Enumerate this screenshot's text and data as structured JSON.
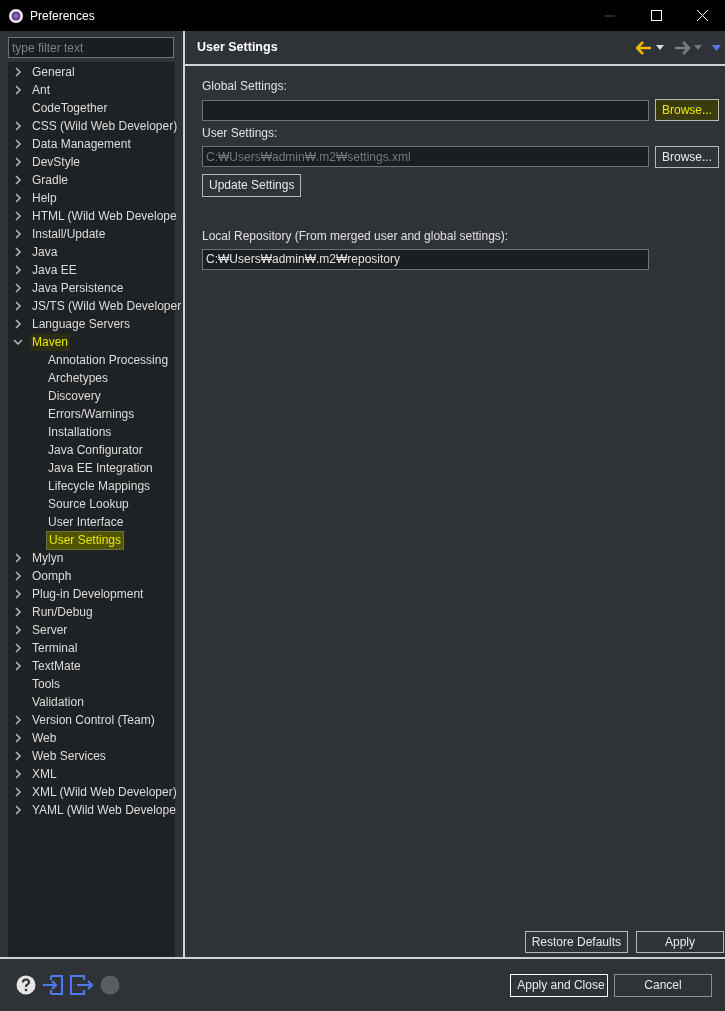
{
  "window": {
    "title": "Preferences"
  },
  "filter": {
    "placeholder": "type filter text"
  },
  "tree": [
    {
      "label": "General",
      "kind": "folder",
      "expanded": false,
      "selected": false
    },
    {
      "label": "Ant",
      "kind": "folder",
      "expanded": false,
      "selected": false
    },
    {
      "label": "CodeTogether",
      "kind": "leaf",
      "selected": false
    },
    {
      "label": "CSS (Wild Web Developer)",
      "kind": "folder",
      "expanded": false,
      "selected": false
    },
    {
      "label": "Data Management",
      "kind": "folder",
      "expanded": false,
      "selected": false
    },
    {
      "label": "DevStyle",
      "kind": "folder",
      "expanded": false,
      "selected": false
    },
    {
      "label": "Gradle",
      "kind": "folder",
      "expanded": false,
      "selected": false
    },
    {
      "label": "Help",
      "kind": "folder",
      "expanded": false,
      "selected": false
    },
    {
      "label": "HTML (Wild Web Develope",
      "kind": "folder",
      "expanded": false,
      "selected": false
    },
    {
      "label": "Install/Update",
      "kind": "folder",
      "expanded": false,
      "selected": false
    },
    {
      "label": "Java",
      "kind": "folder",
      "expanded": false,
      "selected": false
    },
    {
      "label": "Java EE",
      "kind": "folder",
      "expanded": false,
      "selected": false
    },
    {
      "label": "Java Persistence",
      "kind": "folder",
      "expanded": false,
      "selected": false
    },
    {
      "label": "JS/TS (Wild Web Developer",
      "kind": "folder",
      "expanded": false,
      "selected": false
    },
    {
      "label": "Language Servers",
      "kind": "folder",
      "expanded": false,
      "selected": false
    },
    {
      "label": "Maven",
      "kind": "folder",
      "expanded": true,
      "selected": false,
      "highlighted": true,
      "children": [
        {
          "label": "Annotation Processing",
          "kind": "leaf",
          "selected": false
        },
        {
          "label": "Archetypes",
          "kind": "leaf",
          "selected": false
        },
        {
          "label": "Discovery",
          "kind": "leaf",
          "selected": false
        },
        {
          "label": "Errors/Warnings",
          "kind": "leaf",
          "selected": false
        },
        {
          "label": "Installations",
          "kind": "leaf",
          "selected": false
        },
        {
          "label": "Java Configurator",
          "kind": "leaf",
          "selected": false
        },
        {
          "label": "Java EE Integration",
          "kind": "leaf",
          "selected": false
        },
        {
          "label": "Lifecycle Mappings",
          "kind": "leaf",
          "selected": false
        },
        {
          "label": "Source Lookup",
          "kind": "leaf",
          "selected": false
        },
        {
          "label": "User Interface",
          "kind": "leaf",
          "selected": false
        },
        {
          "label": "User Settings",
          "kind": "leaf",
          "selected": true
        }
      ]
    },
    {
      "label": "Mylyn",
      "kind": "folder",
      "expanded": false,
      "selected": false
    },
    {
      "label": "Oomph",
      "kind": "folder",
      "expanded": false,
      "selected": false
    },
    {
      "label": "Plug-in Development",
      "kind": "folder",
      "expanded": false,
      "selected": false
    },
    {
      "label": "Run/Debug",
      "kind": "folder",
      "expanded": false,
      "selected": false
    },
    {
      "label": "Server",
      "kind": "folder",
      "expanded": false,
      "selected": false
    },
    {
      "label": "Terminal",
      "kind": "folder",
      "expanded": false,
      "selected": false
    },
    {
      "label": "TextMate",
      "kind": "folder",
      "expanded": false,
      "selected": false
    },
    {
      "label": "Tools",
      "kind": "leaf",
      "selected": false
    },
    {
      "label": "Validation",
      "kind": "leaf",
      "selected": false
    },
    {
      "label": "Version Control (Team)",
      "kind": "folder",
      "expanded": false,
      "selected": false
    },
    {
      "label": "Web",
      "kind": "folder",
      "expanded": false,
      "selected": false
    },
    {
      "label": "Web Services",
      "kind": "folder",
      "expanded": false,
      "selected": false
    },
    {
      "label": "XML",
      "kind": "folder",
      "expanded": false,
      "selected": false
    },
    {
      "label": "XML (Wild Web Developer)",
      "kind": "folder",
      "expanded": false,
      "selected": false
    },
    {
      "label": "YAML (Wild Web Develope",
      "kind": "folder",
      "expanded": false,
      "selected": false
    }
  ],
  "page": {
    "title": "User Settings",
    "global_settings": {
      "label": "Global Settings:",
      "browse": "Browse...",
      "browse_focused": true
    },
    "user_settings": {
      "label": "User Settings:",
      "value": "C:₩Users₩admin₩.m2₩settings.xml",
      "disabled": true,
      "browse": "Browse...",
      "browse_focused": false
    },
    "update_button": "Update Settings",
    "local_repository": {
      "label": "Local Repository (From merged user and global settings):",
      "value": "C:₩Users₩admin₩.m2₩repository"
    },
    "restore_defaults": "Restore Defaults",
    "apply": "Apply"
  },
  "footer": {
    "apply_and_close": "Apply and Close",
    "cancel": "Cancel"
  }
}
